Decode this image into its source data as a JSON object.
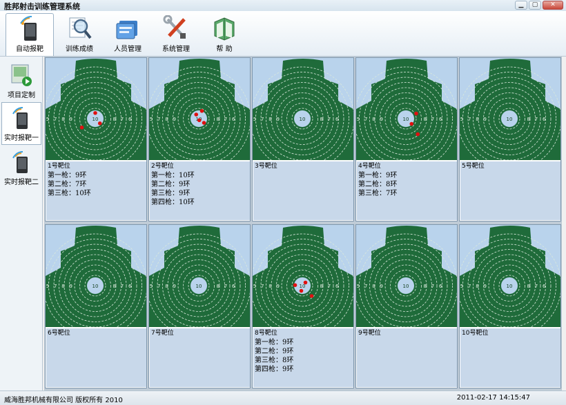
{
  "window": {
    "title": "胜邦射击训练管理系统"
  },
  "toolbar": {
    "items": [
      {
        "label": "自动报靶",
        "icon": "auto-scoring-icon"
      },
      {
        "label": "训练成绩",
        "icon": "magnifier-icon"
      },
      {
        "label": "人员管理",
        "icon": "people-icon"
      },
      {
        "label": "系统管理",
        "icon": "tools-icon"
      },
      {
        "label": "帮  助",
        "icon": "help-book-icon"
      }
    ]
  },
  "sidebar": {
    "items": [
      {
        "label": "项目定制",
        "icon": "project-icon"
      },
      {
        "label": "实时报靶一",
        "icon": "realtime-target-icon"
      },
      {
        "label": "实时报靶二",
        "icon": "realtime-target-icon"
      }
    ]
  },
  "target": {
    "ring_labels": [
      "5",
      "7",
      "8",
      "9",
      "10",
      "8",
      "7",
      "6"
    ]
  },
  "lanes": [
    {
      "label": "1号靶位",
      "shots": [
        "第一枪：9环",
        "第二枪：7环",
        "第三枪：10环"
      ],
      "hits": [
        [
          0,
          -1.1
        ],
        [
          0.9,
          0.9
        ],
        [
          -2.6,
          1.7
        ]
      ]
    },
    {
      "label": "2号靶位",
      "shots": [
        "第一枪：10环",
        "第二枪：9环",
        "第三枪：9环",
        "第四枪：10环"
      ],
      "hits": [
        [
          -0.5,
          -0.8
        ],
        [
          0.6,
          -1.5
        ],
        [
          1.0,
          0.8
        ],
        [
          0.1,
          0.3
        ]
      ]
    },
    {
      "label": "3号靶位",
      "shots": [],
      "hits": []
    },
    {
      "label": "4号靶位",
      "shots": [
        "第一枪：9环",
        "第二枪：8环",
        "第三枪：7环"
      ],
      "hits": [
        [
          2.0,
          -1.0
        ],
        [
          1.1,
          1.0
        ],
        [
          2.3,
          3.0
        ]
      ]
    },
    {
      "label": "5号靶位",
      "shots": [],
      "hits": []
    },
    {
      "label": "6号靶位",
      "shots": [],
      "hits": []
    },
    {
      "label": "7号靶位",
      "shots": [],
      "hits": []
    },
    {
      "label": "8号靶位",
      "shots": [
        "第一枪：9环",
        "第二枪：9环",
        "第三枪：8环",
        "第四枪：9环"
      ],
      "hits": [
        [
          -1.4,
          -0.1
        ],
        [
          0.6,
          -0.6
        ],
        [
          -0.2,
          1.0
        ],
        [
          1.8,
          2.0
        ]
      ]
    },
    {
      "label": "9号靶位",
      "shots": [],
      "hits": []
    },
    {
      "label": "10号靶位",
      "shots": [],
      "hits": []
    }
  ],
  "status": {
    "copyright": "威海胜邦机械有限公司 版权所有 2010",
    "datetime": "2011-02-17 14:15:47"
  },
  "colors": {
    "target_green": "#1f6b3a",
    "sky": "#b9d3ec",
    "hit": "#e01010"
  }
}
